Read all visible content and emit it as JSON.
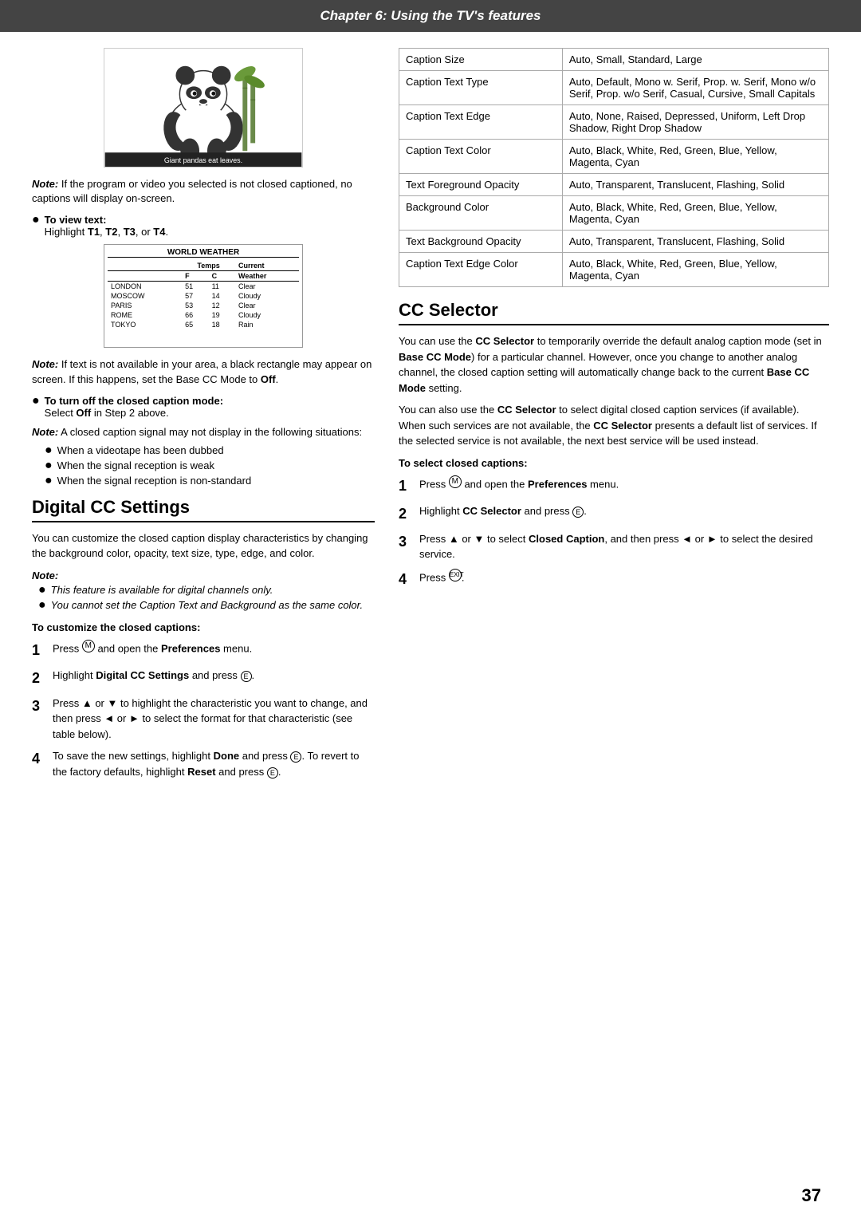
{
  "header": {
    "title": "Chapter 6: Using the TV's features"
  },
  "panda_image": {
    "caption": "Giant pandas eat leaves."
  },
  "weather_image": {
    "title": "WORLD WEATHER",
    "columns": [
      "",
      "Temps",
      "",
      "Current"
    ],
    "subcolumns": [
      "",
      "F",
      "C",
      "Weather"
    ],
    "rows": [
      [
        "LONDON",
        "51",
        "11",
        "Clear"
      ],
      [
        "MOSCOW",
        "57",
        "14",
        "Cloudy"
      ],
      [
        "PARIS",
        "53",
        "12",
        "Clear"
      ],
      [
        "ROME",
        "66",
        "19",
        "Cloudy"
      ],
      [
        "TOKYO",
        "65",
        "18",
        "Rain"
      ]
    ]
  },
  "left": {
    "note1": {
      "label": "Note:",
      "text": "If the program or video you selected is not closed captioned, no captions will display on-screen."
    },
    "view_text": {
      "label": "To view text:",
      "text": "Highlight T1, T2, T3, or T4."
    },
    "note2": {
      "label": "Note:",
      "text": "If text is not available in your area, a black rectangle may appear on screen. If this happens, set the Base CC Mode to Off."
    },
    "turn_off": {
      "label": "To turn off the closed caption mode:",
      "text": "Select Off in Step 2 above."
    },
    "note3": {
      "label": "Note:",
      "text": "A closed caption signal may not display in the following situations:"
    },
    "bullets": [
      "When a videotape has been dubbed",
      "When the signal reception is weak",
      "When the signal reception is non-standard"
    ],
    "digital_cc_title": "Digital CC Settings",
    "digital_cc_para": "You can customize the closed caption display characteristics by changing the background color, opacity, text size, type, edge, and color.",
    "note4_label": "Note:",
    "note4_bullets": [
      "This feature is available for digital channels only.",
      "You cannot set the Caption Text and Background as the same color."
    ],
    "customize_heading": "To customize the closed captions:",
    "steps": [
      {
        "num": "1",
        "text_parts": [
          {
            "text": "Press ",
            "style": "normal"
          },
          {
            "text": "MENU",
            "style": "superscript"
          },
          {
            "text": " and open the ",
            "style": "normal"
          },
          {
            "text": "Preferences",
            "style": "bold"
          },
          {
            "text": " menu.",
            "style": "normal"
          }
        ],
        "text": "Press MENU and open the Preferences menu."
      },
      {
        "num": "2",
        "text": "Highlight Digital CC Settings and press ENTER."
      },
      {
        "num": "3",
        "text": "Press ▲ or ▼ to highlight the characteristic you want to change, and then press ◄ or ► to select the format for that characteristic (see table below)."
      },
      {
        "num": "4",
        "text": "To save the new settings, highlight Done and press ENTER. To revert to the factory defaults, highlight Reset and press ENTER."
      }
    ]
  },
  "right": {
    "table": {
      "rows": [
        {
          "label": "Caption Size",
          "value": "Auto, Small, Standard, Large"
        },
        {
          "label": "Caption Text Type",
          "value": "Auto, Default, Mono w. Serif, Prop. w. Serif, Mono w/o Serif, Prop. w/o Serif, Casual, Cursive, Small Capitals"
        },
        {
          "label": "Caption Text Edge",
          "value": "Auto, None, Raised, Depressed, Uniform, Left Drop Shadow, Right Drop Shadow"
        },
        {
          "label": "Caption Text Color",
          "value": "Auto, Black, White, Red, Green, Blue, Yellow, Magenta, Cyan"
        },
        {
          "label": "Text Foreground Opacity",
          "value": "Auto, Transparent, Translucent, Flashing, Solid"
        },
        {
          "label": "Background Color",
          "value": "Auto, Black, White, Red, Green, Blue, Yellow, Magenta, Cyan"
        },
        {
          "label": "Text Background Opacity",
          "value": "Auto, Transparent, Translucent, Flashing, Solid"
        },
        {
          "label": "Caption Text Edge Color",
          "value": "Auto, Black, White, Red, Green, Blue, Yellow, Magenta, Cyan"
        }
      ]
    },
    "cc_selector_title": "CC Selector",
    "cc_para1": "You can use the CC Selector to temporarily override the default analog caption mode (set in Base CC Mode) for a particular channel. However, once you change to another analog channel, the closed caption setting will automatically change back to the current Base CC Mode setting.",
    "cc_para2": "You can also use the CC Selector to select digital closed caption services (if available). When such services are not available, the CC Selector presents a default list of services. If the selected service is not available, the next best service will be used instead.",
    "select_heading": "To select closed captions:",
    "steps": [
      {
        "num": "1",
        "text": "Press MENU and open the Preferences menu."
      },
      {
        "num": "2",
        "text": "Highlight CC Selector and press ENTER."
      },
      {
        "num": "3",
        "text": "Press ▲ or ▼ to select Closed Caption, and then press ◄ or ► to select the desired service."
      },
      {
        "num": "4",
        "text": "Press EXIT."
      }
    ]
  },
  "page_number": "37"
}
